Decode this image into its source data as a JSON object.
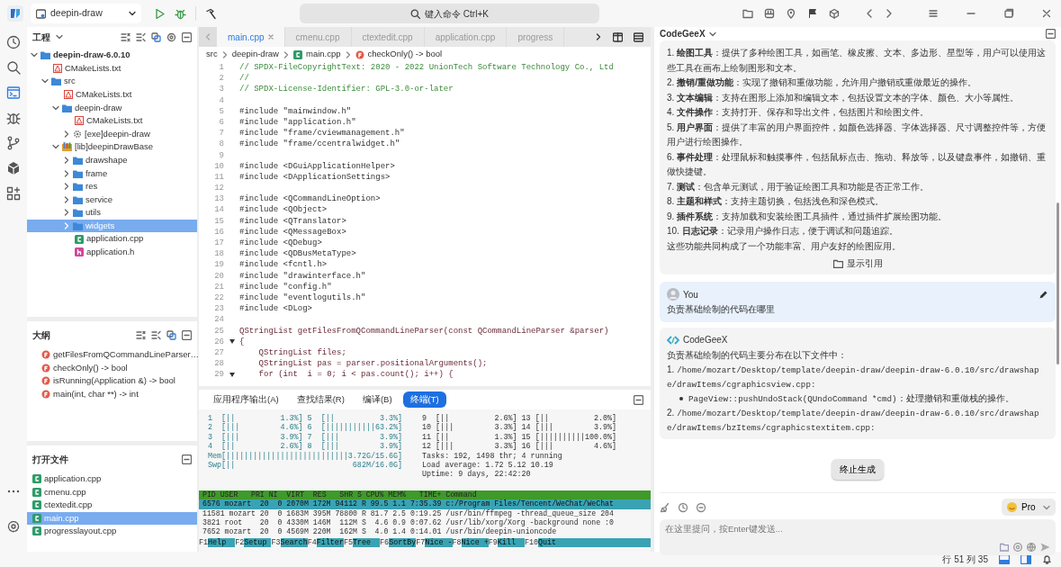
{
  "topbar": {
    "project_selector": "deepin-draw",
    "command_search": "键入命令 Ctrl+K"
  },
  "activity_bar": [
    {
      "kind": "history",
      "selected": false
    },
    {
      "kind": "search",
      "selected": false
    },
    {
      "kind": "editor",
      "selected": true
    },
    {
      "kind": "debug",
      "selected": false
    },
    {
      "kind": "git",
      "selected": false
    },
    {
      "kind": "package",
      "selected": false
    },
    {
      "kind": "extensions",
      "selected": false
    }
  ],
  "project_panel": {
    "title": "工程",
    "tree": [
      {
        "label": "deepin-draw-6.0.10",
        "kind": "project",
        "expanded": true,
        "selected": false,
        "children": [
          {
            "label": "CMakeLists.txt",
            "kind": "cmake",
            "selected": false
          },
          {
            "label": "src",
            "kind": "folder",
            "expanded": true,
            "selected": false,
            "children": [
              {
                "label": "CMakeLists.txt",
                "kind": "cmake",
                "selected": false
              },
              {
                "label": "deepin-draw",
                "kind": "folder",
                "expanded": true,
                "selected": false,
                "children": [
                  {
                    "label": "CMakeLists.txt",
                    "kind": "cmake",
                    "selected": false
                  },
                  {
                    "label": "[exe]deepin-draw",
                    "kind": "exe",
                    "expanded": false,
                    "selected": false
                  }
                ]
              },
              {
                "label": "[lib]deepinDrawBase",
                "kind": "lib",
                "expanded": true,
                "selected": false,
                "children": [
                  {
                    "label": "drawshape",
                    "kind": "folder",
                    "expanded": false,
                    "selected": false
                  },
                  {
                    "label": "frame",
                    "kind": "folder",
                    "expanded": false,
                    "selected": false
                  },
                  {
                    "label": "res",
                    "kind": "folder",
                    "expanded": false,
                    "selected": false
                  },
                  {
                    "label": "service",
                    "kind": "folder",
                    "expanded": false,
                    "selected": false
                  },
                  {
                    "label": "utils",
                    "kind": "folder",
                    "expanded": false,
                    "selected": false
                  },
                  {
                    "label": "widgets",
                    "kind": "folder",
                    "expanded": false,
                    "selected": true
                  },
                  {
                    "label": "application.cpp",
                    "kind": "cpp",
                    "selected": false
                  },
                  {
                    "label": "application.h",
                    "kind": "h",
                    "selected": false
                  }
                ]
              }
            ]
          }
        ]
      }
    ]
  },
  "outline_panel": {
    "title": "大纲",
    "items": [
      {
        "label": "getFilesFromQCommandLineParser…"
      },
      {
        "label": "checkOnly() -> bool"
      },
      {
        "label": "isRunning(Application &) -> bool"
      },
      {
        "label": "main(int, char **) -> int"
      }
    ]
  },
  "open_files_panel": {
    "title": "打开文件",
    "items": [
      {
        "label": "application.cpp",
        "selected": false
      },
      {
        "label": "cmenu.cpp",
        "selected": false
      },
      {
        "label": "ctextedit.cpp",
        "selected": false
      },
      {
        "label": "main.cpp",
        "selected": true
      },
      {
        "label": "progresslayout.cpp",
        "selected": false
      }
    ]
  },
  "editor": {
    "tabs": [
      {
        "label": "main.cpp",
        "selected": true
      },
      {
        "label": "cmenu.cpp",
        "selected": false
      },
      {
        "label": "ctextedit.cpp",
        "selected": false
      },
      {
        "label": "application.cpp",
        "selected": false
      },
      {
        "label": "progress",
        "selected": false
      }
    ],
    "breadcrumb": [
      {
        "label": "src",
        "kind": "folder"
      },
      {
        "label": "deepin-draw",
        "kind": "folder"
      },
      {
        "label": "main.cpp",
        "kind": "cpp"
      },
      {
        "label": "checkOnly() -> bool",
        "kind": "function"
      }
    ],
    "lines": [
      {
        "n": "1",
        "kind": "comment",
        "text": "// SPDX-FileCopyrightText: 2020 - 2022 UnionTech Software Technology Co., Ltd",
        "fold": false
      },
      {
        "n": "2",
        "kind": "comment",
        "text": "//",
        "fold": false
      },
      {
        "n": "3",
        "kind": "comment",
        "text": "// SPDX-License-Identifier: GPL-3.0-or-later",
        "fold": false
      },
      {
        "n": "4",
        "kind": "blank",
        "fold": false
      },
      {
        "n": "5",
        "kind": "include",
        "text": "#include \"mainwindow.h\"",
        "fold": false
      },
      {
        "n": "6",
        "kind": "include",
        "text": "#include \"application.h\"",
        "fold": false
      },
      {
        "n": "7",
        "kind": "include",
        "text": "#include \"frame/cviewmanagement.h\"",
        "fold": false
      },
      {
        "n": "8",
        "kind": "include",
        "text": "#include \"frame/ccentralwidget.h\"",
        "fold": false
      },
      {
        "n": "9",
        "kind": "blank",
        "fold": false
      },
      {
        "n": "10",
        "kind": "include",
        "text": "#include <DGuiApplicationHelper>",
        "fold": false
      },
      {
        "n": "11",
        "kind": "include",
        "text": "#include <DApplicationSettings>",
        "fold": false
      },
      {
        "n": "12",
        "kind": "blank",
        "fold": false
      },
      {
        "n": "13",
        "kind": "include",
        "text": "#include <QCommandLineOption>",
        "fold": false
      },
      {
        "n": "14",
        "kind": "include",
        "text": "#include <QObject>",
        "fold": false
      },
      {
        "n": "15",
        "kind": "include",
        "text": "#include <QTranslator>",
        "fold": false
      },
      {
        "n": "16",
        "kind": "include",
        "text": "#include <QMessageBox>",
        "fold": false
      },
      {
        "n": "17",
        "kind": "include",
        "text": "#include <QDebug>",
        "fold": false
      },
      {
        "n": "18",
        "kind": "include",
        "text": "#include <QDBusMetaType>",
        "fold": false
      },
      {
        "n": "19",
        "kind": "include",
        "text": "#include <fcntl.h>",
        "fold": false
      },
      {
        "n": "20",
        "kind": "include",
        "text": "#include \"drawinterface.h\"",
        "fold": false
      },
      {
        "n": "21",
        "kind": "include",
        "text": "#include \"config.h\"",
        "fold": false
      },
      {
        "n": "22",
        "kind": "include",
        "text": "#include \"eventlogutils.h\"",
        "fold": false
      },
      {
        "n": "23",
        "kind": "include",
        "text": "#include <DLog>",
        "fold": false
      },
      {
        "n": "24",
        "kind": "blank",
        "fold": false
      },
      {
        "n": "25",
        "kind": "code",
        "text": "QStringList getFilesFromQCommandLineParser(const QCommandLineParser &parser)",
        "fold": false
      },
      {
        "n": "26",
        "kind": "code",
        "text": "{",
        "fold": true
      },
      {
        "n": "27",
        "kind": "code",
        "text": "    QStringList files;",
        "fold": false
      },
      {
        "n": "28",
        "kind": "code",
        "text": "    QStringList pas = parser.positionalArguments();",
        "fold": false
      },
      {
        "n": "29",
        "kind": "code",
        "text": "    for (int  i = 0; i < pas.count(); i++) {",
        "fold": true
      }
    ]
  },
  "bottom_panel": {
    "tabs": [
      {
        "label": "应用程序输出(A)",
        "selected": false
      },
      {
        "label": "查找结果(R)",
        "selected": false
      },
      {
        "label": "编译(B)",
        "selected": false
      },
      {
        "label": "终端(T)",
        "selected": true
      }
    ],
    "terminal": {
      "meters": [
        {
          "left": "1  [||          1.3%] 5  [||          3.3%]",
          "right": "9  [||          2.6%] 13 [||          2.0%]"
        },
        {
          "left": "2  [|||         4.6%] 6  [|||||||||||63.2%]",
          "right": "10 [|||         3.3%] 14 [|||         3.9%]"
        },
        {
          "left": "3  [|||         3.9%] 7  [|||         3.9%]",
          "right": "11 [||          1.3%] 15 [||||||||||100.0%]"
        },
        {
          "left": "4  [||          2.6%] 8  [|||         3.9%]",
          "right": "12 [|||         3.3%] 16 [|||         4.6%]"
        },
        {
          "left": "Mem[|||||||||||||||||||||||||||3.72G/15.6G]",
          "right": "Tasks: 192, 1498 thr; 4 running"
        },
        {
          "left": "Swp[||                          682M/16.0G]",
          "right": "Load average: 1.72 5.12 10.19"
        },
        {
          "right": "Uptime: 9 days, 22:42:20"
        }
      ],
      "header": "PID USER   PRI NI  VIRT  RES   SHR S CPU% MEM%   TIME+ Command",
      "rows": [
        {
          "text": "6576 mozart  20  0 2070M 172M 94112 R 99.5 1.1 7:35.39 c:/Program Files/Tencent/WeChat/WeChat",
          "selected": true
        },
        {
          "text": "11581 mozart 20  0 1683M 395M 78800 R 81.7 2.5 0:19.25 /usr/bin/ffmpeg -thread_queue_size 204",
          "selected": false
        },
        {
          "text": "3821 root    20  0 4330M 146M  112M S  4.6 0.9 0:07.62 /usr/lib/xorg/Xorg -background none :0",
          "selected": false
        },
        {
          "text": "7652 mozart  20  0 4569M 220M  162M S  4.0 1.4 0:14.01 /usr/bin/deepin-unioncode",
          "selected": false
        }
      ],
      "keys": [
        {
          "key": "F1",
          "label": "Help  "
        },
        {
          "key": "F2",
          "label": "Setup "
        },
        {
          "key": "F3",
          "label": "Search"
        },
        {
          "key": "F4",
          "label": "Filter"
        },
        {
          "key": "F5",
          "label": "Tree  "
        },
        {
          "key": "F6",
          "label": "SortBy"
        },
        {
          "key": "F7",
          "label": "Nice -"
        },
        {
          "key": "F8",
          "label": "Nice +"
        },
        {
          "key": "F9",
          "label": "Kill  "
        },
        {
          "key": "F10",
          "label": "Quit"
        }
      ]
    }
  },
  "chat": {
    "title": "CodeGeeX",
    "answer": {
      "paragraphs": [
        "1. **绘图工具**：提供了多种绘图工具，如画笔、橡皮擦、文本、多边形、星型等，用户可以使用这些工具在画布上绘制图形和文本。",
        "2. **撤销/重做功能**：实现了撤销和重做功能，允许用户撤销或重做最近的操作。",
        "3. **文本编辑**：支持在图形上添加和编辑文本，包括设置文本的字体、颜色、大小等属性。",
        "4. **文件操作**：支持打开、保存和导出文件，包括图片和绘图文件。",
        "5. **用户界面**：提供了丰富的用户界面控件，如颜色选择器、字体选择器、尺寸调整控件等，方便用户进行绘图操作。",
        "6. **事件处理**：处理鼠标和触摸事件，包括鼠标点击、拖动、释放等，以及键盘事件，如撤销、重做快捷键。",
        "7. **测试**：包含单元测试，用于验证绘图工具和功能是否正常工作。",
        "8. **主题和样式**：支持主题切换，包括浅色和深色模式。",
        "9. **插件系统**：支持加载和安装绘图工具插件，通过插件扩展绘图功能。",
        "10. **日志记录**：记录用户操作日志，便于调试和问题追踪。",
        "这些功能共同构成了一个功能丰富、用户友好的绘图应用。"
      ],
      "action": "显示引用"
    },
    "user": {
      "author": "You",
      "text": "负责基础绘制的代码在哪里"
    },
    "reply": {
      "author": "CodeGeeX",
      "intro": "负责基础绘制的代码主要分布在以下文件中：",
      "items": [
        {
          "number": "1.",
          "path": "/home/mozart/Desktop/template/deepin-draw/deepin-draw-6.0.10/src/drawshape/drawItems/cgraphicsview.cpp:",
          "sub": [
            {
              "code": "PageView::pushUndoStack(QUndoCommand *cmd)",
              "text": "：处理撤销和重做栈的操作。"
            }
          ]
        },
        {
          "number": "2.",
          "path": "/home/mozart/Desktop/template/deepin-draw/deepin-draw-6.0.10/src/drawshape/drawItems/bzItems/cgraphicstextitem.cpp:"
        }
      ]
    },
    "stop_button": "终止生成",
    "model": "Pro",
    "input_placeholder": "在这里提问，按Enter键发送..."
  },
  "status_bar": {
    "position": "行 51 列 35"
  }
}
